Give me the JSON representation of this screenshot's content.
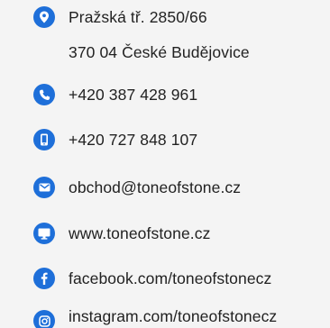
{
  "accent_color": "#1e6fd9",
  "text_color": "#222222",
  "background_color": "#f4f4f4",
  "contacts": {
    "address": {
      "icon": "location-pin-icon",
      "line1": "Pražská tř. 2850/66",
      "line2": "370 04 České Budějovice"
    },
    "phone": {
      "icon": "phone-icon",
      "label": "+420 387 428 961"
    },
    "mobile": {
      "icon": "mobile-phone-icon",
      "label": "+420 727 848 107"
    },
    "email": {
      "icon": "envelope-icon",
      "label": "obchod@toneofstone.cz"
    },
    "web": {
      "icon": "monitor-icon",
      "label": "www.toneofstone.cz"
    },
    "facebook": {
      "icon": "facebook-icon",
      "label": "facebook.com/toneofstonecz"
    },
    "instagram": {
      "icon": "instagram-icon",
      "label": "instagram.com/toneofstonecz"
    }
  }
}
